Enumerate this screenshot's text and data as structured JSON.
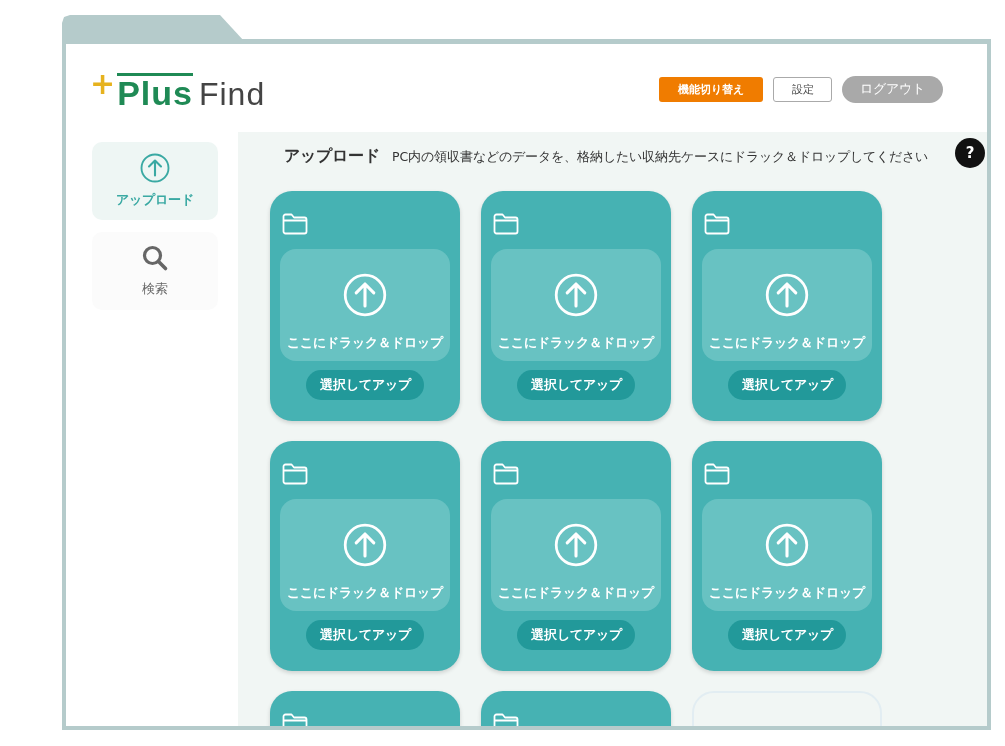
{
  "logo": {
    "mark": "+",
    "name": "Plus",
    "suffix": "Find"
  },
  "header_buttons": [
    {
      "label": "機能切り替え",
      "kind": "primary"
    },
    {
      "label": "設定",
      "kind": "outline"
    },
    {
      "label": "ログアウト",
      "kind": "pill"
    }
  ],
  "help": {
    "label": "?"
  },
  "sidebar": {
    "items": [
      {
        "label": "アップロード",
        "kind": "upload",
        "selected": true
      },
      {
        "label": "検索",
        "kind": "search",
        "selected": false
      }
    ]
  },
  "main": {
    "title": "アップロード",
    "description": "PC内の領収書などのデータを、格納したい収納先ケースにドラック＆ドロップしてください",
    "cards": [
      {
        "kind": "upload",
        "drop_text": "ここにドラック＆ドロップ",
        "button": "選択してアップ"
      },
      {
        "kind": "upload",
        "drop_text": "ここにドラック＆ドロップ",
        "button": "選択してアップ"
      },
      {
        "kind": "upload",
        "drop_text": "ここにドラック＆ドロップ",
        "button": "選択してアップ"
      },
      {
        "kind": "upload",
        "drop_text": "ここにドラック＆ドロップ",
        "button": "選択してアップ"
      },
      {
        "kind": "upload",
        "drop_text": "ここにドラック＆ドロップ",
        "button": "選択してアップ"
      },
      {
        "kind": "upload",
        "drop_text": "ここにドラック＆ドロップ",
        "button": "選択してアップ"
      },
      {
        "kind": "partial"
      },
      {
        "kind": "partial"
      },
      {
        "kind": "empty"
      }
    ]
  }
}
